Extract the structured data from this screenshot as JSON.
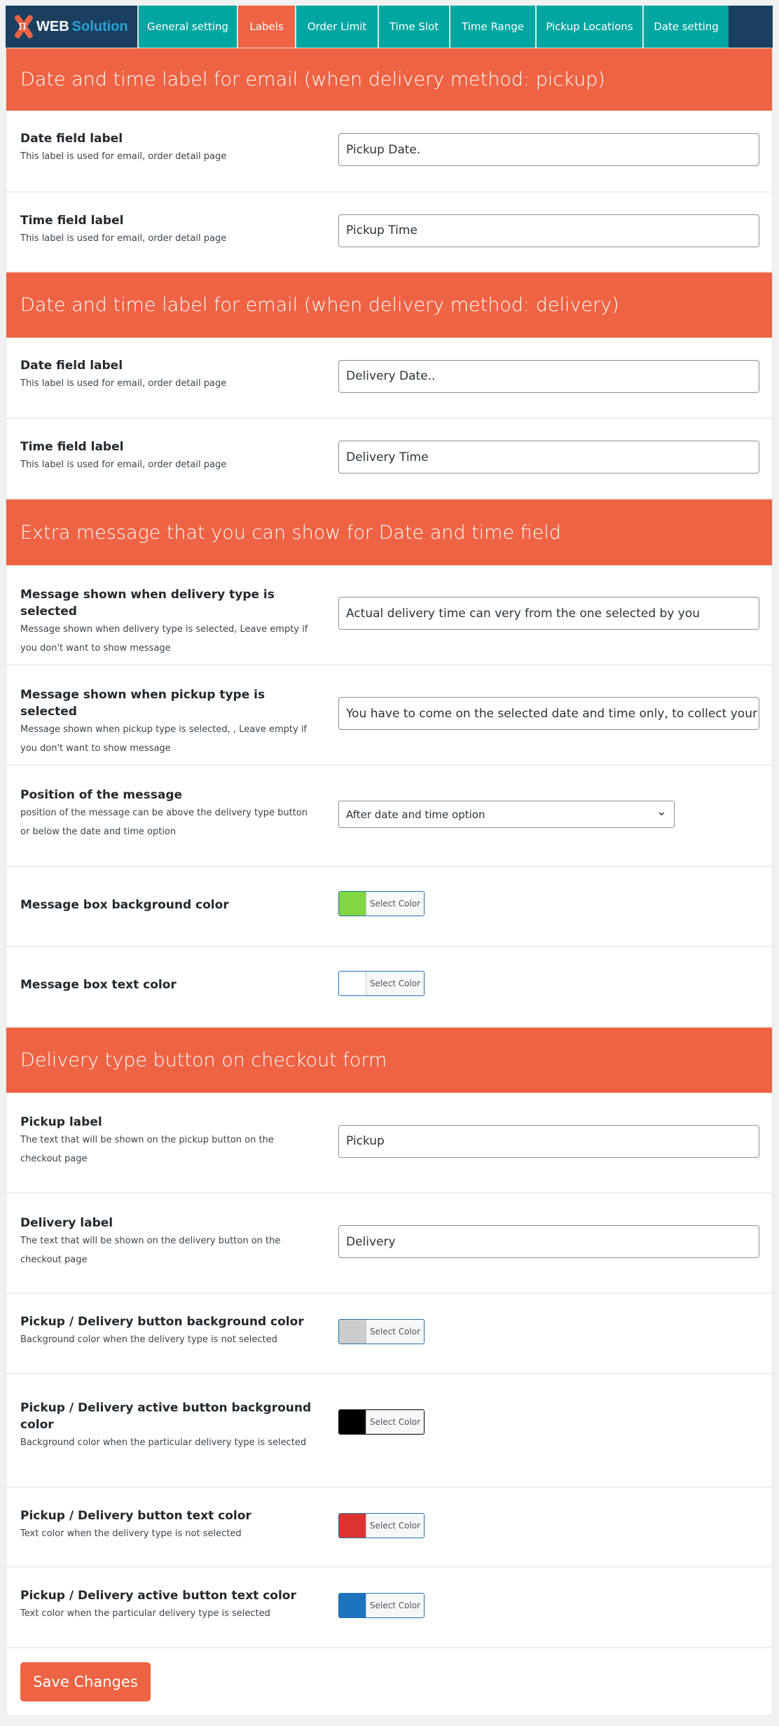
{
  "logo": {
    "brand_a": "WEB",
    "brand_b": "Solution",
    "symbol": "π"
  },
  "nav": {
    "tabs": [
      {
        "label": "General setting",
        "active": false
      },
      {
        "label": "Labels",
        "active": true
      },
      {
        "label": "Order Limit",
        "active": false
      },
      {
        "label": "Time Slot",
        "active": false
      },
      {
        "label": "Time Range",
        "active": false
      },
      {
        "label": "Pickup Locations",
        "active": false
      },
      {
        "label": "Date setting",
        "active": false
      }
    ]
  },
  "colors": {
    "accent": "#ee6343",
    "tab": "#00a6a1",
    "nav": "#1b3f5e"
  },
  "sections": [
    {
      "title": "Date and time label for email (when delivery method: pickup)",
      "rows": [
        {
          "type": "text",
          "label": "Date field label",
          "desc": "This label is used for email, order detail page",
          "value": "Pickup Date."
        },
        {
          "type": "text",
          "label": "Time field label",
          "desc": "This label is used for email, order detail page",
          "value": "Pickup Time"
        }
      ]
    },
    {
      "title": "Date and time label for email (when delivery method: delivery)",
      "rows": [
        {
          "type": "text",
          "label": "Date field label",
          "desc": "This label is used for email, order detail page",
          "value": "Delivery Date.."
        },
        {
          "type": "text",
          "label": "Time field label",
          "desc": "This label is used for email, order detail page",
          "value": "Delivery Time"
        }
      ]
    },
    {
      "title": "Extra message that you can show for Date and time field",
      "rows": [
        {
          "type": "text",
          "label": "Message shown when delivery type is selected",
          "desc": "Message shown when delivery type is selected, Leave empty if you don't want to show message",
          "value": "Actual delivery time can very from the one selected by you"
        },
        {
          "type": "text",
          "label": "Message shown when pickup type is selected",
          "desc": "Message shown when pickup type is selected, , Leave empty if you don't want to show message",
          "value": "You have to come on the selected date and time only, to collect your"
        },
        {
          "type": "select",
          "label": "Position of the message",
          "desc": "position of the message can be above the delivery type button or below the date and time option",
          "value": "After date and time option"
        },
        {
          "type": "color",
          "label": "Message box background color",
          "desc": "",
          "color": "#81d742",
          "button": "Select Color"
        },
        {
          "type": "color",
          "label": "Message box text color",
          "desc": "",
          "color": "#ffffff",
          "button": "Select Color"
        }
      ]
    },
    {
      "title": "Delivery type button on checkout form",
      "rows": [
        {
          "type": "text",
          "label": "Pickup label",
          "desc": "The text that will be shown on the pickup button on the checkout page",
          "value": "Pickup"
        },
        {
          "type": "text",
          "label": "Delivery label",
          "desc": "The text that will be shown on the delivery button on the checkout page",
          "value": "Delivery"
        },
        {
          "type": "color",
          "label": "Pickup / Delivery button background color",
          "desc": "Background color when the delivery type is not selected",
          "color": "#cccccc",
          "button": "Select Color"
        },
        {
          "type": "color",
          "label": "Pickup / Delivery active button background color",
          "desc": "Background color when the particular delivery type is selected",
          "color": "#000000",
          "button": "Select Color"
        },
        {
          "type": "color",
          "label": "Pickup / Delivery button text color",
          "desc": "Text color when the delivery type is not selected",
          "color": "#dd3333",
          "button": "Select Color"
        },
        {
          "type": "color",
          "label": "Pickup / Delivery active button text color",
          "desc": "Text color when the particular delivery type is selected",
          "color": "#1e73be",
          "button": "Select Color"
        }
      ]
    }
  ],
  "save_label": "Save Changes"
}
